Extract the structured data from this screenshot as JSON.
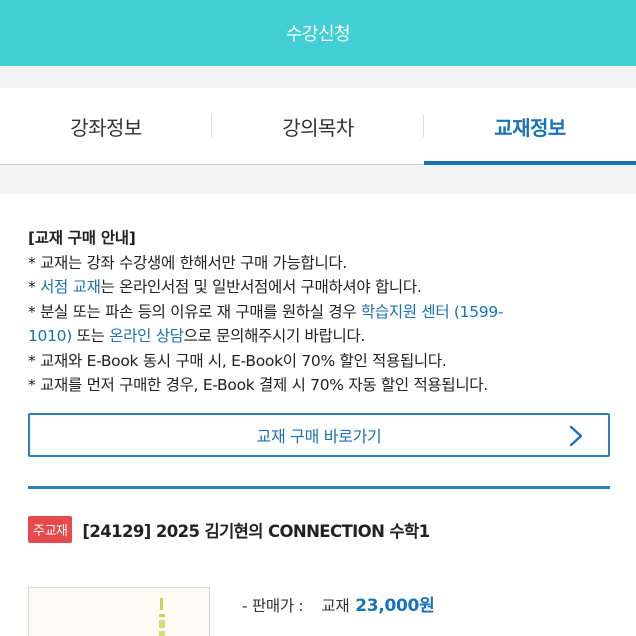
{
  "header": {
    "title": "수강신청"
  },
  "tabs": [
    {
      "label": "강좌정보",
      "active": false
    },
    {
      "label": "강의목차",
      "active": false
    },
    {
      "label": "교재정보",
      "active": true
    }
  ],
  "notice": {
    "heading": "[교재 구매 안내]",
    "line1": "* 교재는 강좌 수강생에 한해서만 구매 가능합니다.",
    "line2_prefix": "* ",
    "line2_link": "서점 교재",
    "line2_suffix": "는 온라인서점 및 일반서점에서 구매하셔야 합니다.",
    "line3_prefix": "* 분실 또는 파손 등의 이유로 재 구매를 원하실 경우 ",
    "line3_link1": "학습지원 센터 (1599-",
    "line4_link1": "1010)",
    "line4_mid": " 또는 ",
    "line4_link2": "온라인 상담",
    "line4_suffix": "으로 문의해주시기 바랍니다.",
    "line5": "* 교재와 E-Book 동시 구매 시, E-Book이 70% 할인 적용됩니다.",
    "line6": "* 교재를 먼저 구매한 경우, E-Book 결제 시 70% 자동 할인 적용됩니다."
  },
  "cta": {
    "label": "교재 구매 바로가기",
    "icon": "chevron-right-icon"
  },
  "book": {
    "badge": "주교재",
    "title": "[24129] 2025 김기현의 CONNECTION 수학1",
    "price_label": "- 판매가 :",
    "price_kind": "교재",
    "price_value": "23,000원"
  },
  "colors": {
    "header_bg": "#42cfd3",
    "accent": "#1a72b8",
    "badge": "#e54b4b"
  }
}
